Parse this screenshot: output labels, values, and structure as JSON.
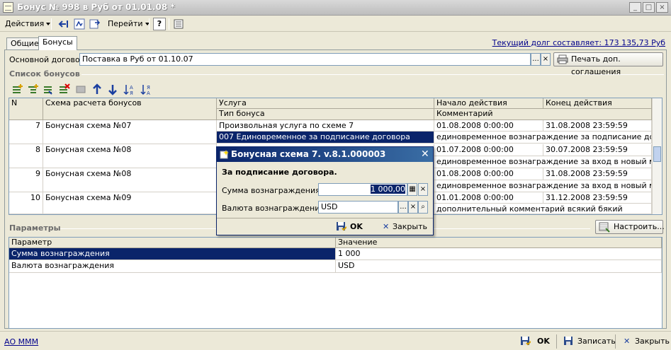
{
  "window": {
    "title": "Бонус № 998 в Руб от 01.01.08 *",
    "controls": [
      "_",
      "□",
      "×"
    ]
  },
  "toolbar": {
    "actions_label": "Действия",
    "goto_label": "Перейти",
    "help_label": "?"
  },
  "debt_link": "Текущий долг составляет: 173 135,73 Руб",
  "tabs": [
    {
      "label": "Общие",
      "active": false
    },
    {
      "label": "Бонусы",
      "active": true
    }
  ],
  "contract": {
    "label": "Основной договор:",
    "value": "Поставка в Руб от 01.10.07",
    "choose": "...",
    "clear": "×",
    "print_label": "Печать доп. соглашения"
  },
  "bonus_list": {
    "title": "Список бонусов",
    "columns": {
      "n": "N",
      "scheme": "Схема расчета бонусов",
      "service": "Услуга",
      "bonus_type": "Тип бонуса",
      "start": "Начало действия",
      "comment": "Комментарий",
      "end": "Конец действия"
    },
    "rows": [
      {
        "n": "7",
        "scheme": "Бонусная схема №07",
        "service": "Произвольная услуга по схеме 7",
        "bonus_type": "007 Единовременное за подписание договора",
        "start": "01.08.2008 0:00:00",
        "end": "31.08.2008 23:59:59",
        "comment": "единовременное вознаграждение за подписание договора"
      },
      {
        "n": "8",
        "scheme": "Бонусная схема №08",
        "service": "",
        "bonus_type": "",
        "start": "01.07.2008 0:00:00",
        "end": "30.07.2008 23:59:59",
        "comment": "единовременное вознаграждение за вход в новый магаз..."
      },
      {
        "n": "9",
        "scheme": "Бонусная схема №08",
        "service": "",
        "bonus_type": "",
        "start": "01.08.2008 0:00:00",
        "end": "31.08.2008 23:59:59",
        "comment": "единовременное вознаграждение за вход в новый магаз..."
      },
      {
        "n": "10",
        "scheme": "Бонусная схема №09",
        "service": "",
        "bonus_type": "",
        "start": "01.01.2008 0:00:00",
        "end": "31.12.2008 23:59:59",
        "comment": "дополнительный комментарий всякий бякий"
      }
    ]
  },
  "params": {
    "title": "Параметры",
    "configure_label": "Настроить...",
    "columns": {
      "param": "Параметр",
      "value": "Значение"
    },
    "rows": [
      {
        "param": "Сумма вознаграждения",
        "value": "1 000"
      },
      {
        "param": "Валюта вознаграждения",
        "value": "USD"
      }
    ]
  },
  "dialog": {
    "title": "Бонусная схема 7. v.8.1.000003",
    "heading": "За подписание договора.",
    "amount_label": "Сумма вознаграждения:",
    "amount_value": "1 000,00",
    "currency_label": "Валюта вознаграждения:",
    "currency_value": "USD",
    "ok_label": "OK",
    "close_label": "Закрыть"
  },
  "statusbar": {
    "org_link": "АО МММ",
    "ok_label": "OK",
    "save_label": "Записать",
    "close_label": "Закрыть"
  },
  "colors": {
    "selection": "#0a246a",
    "link": "#00008b",
    "window_bg": "#ece9d8"
  }
}
